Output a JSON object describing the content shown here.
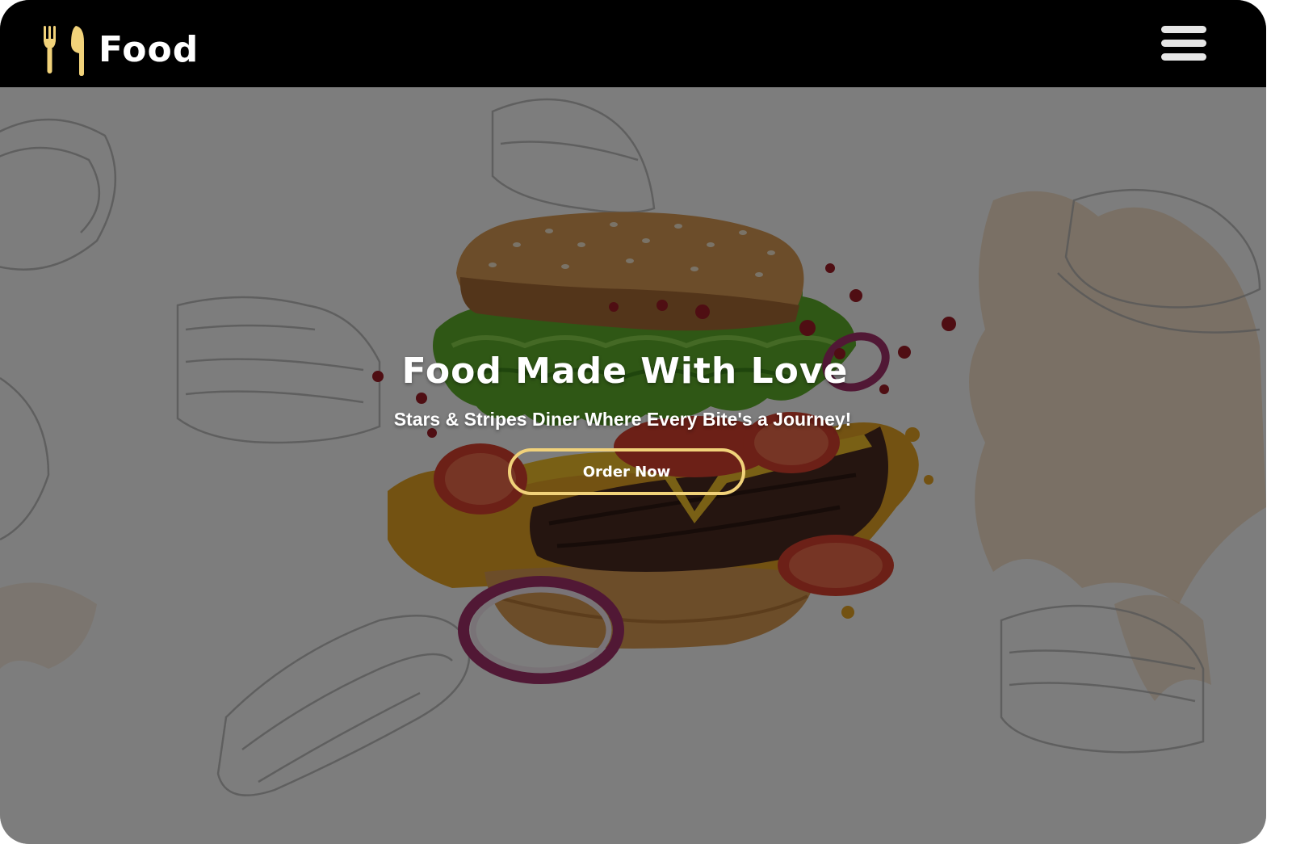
{
  "header": {
    "brand_name": "Food",
    "logo_icon": "fork-knife-icon",
    "menu_icon": "hamburger-menu-icon",
    "brand_color": "#f1d27a"
  },
  "hero": {
    "title": "Food Made With Love",
    "subtitle": "Stars & Stripes Diner Where Every Bite's a Journey!",
    "cta_label": "Order Now",
    "background_image": "flying-burger-with-food-sketches"
  }
}
